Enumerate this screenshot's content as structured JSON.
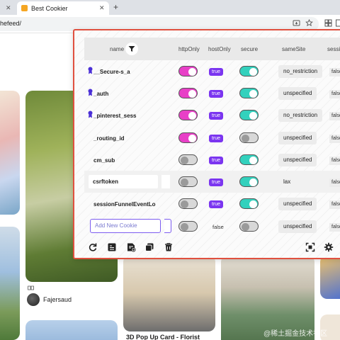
{
  "browser": {
    "tab_inactive_close": "✕",
    "tab_active_title": "Best Cookier",
    "tab_active_close": "✕",
    "new_tab": "+",
    "url": "hefeed/"
  },
  "page": {
    "author_name": "Fajersaud",
    "pin_title": "3D Pop Up Card - Florist",
    "watermark": "@稀土掘金技术社区"
  },
  "cookier": {
    "columns": {
      "name": "name",
      "httpOnly": "httpOnly",
      "hostOnly": "hostOnly",
      "secure": "secure",
      "sameSite": "sameSite",
      "session": "sessio"
    },
    "rows": [
      {
        "name": "__Secure-s_a",
        "pinned": true,
        "httpOnly": true,
        "hostOnly": "true",
        "secure": true,
        "sameSite": "no_restriction",
        "session": "false"
      },
      {
        "name": "_auth",
        "pinned": true,
        "httpOnly": true,
        "hostOnly": "true",
        "secure": true,
        "sameSite": "unspecified",
        "session": "false"
      },
      {
        "name": "_pinterest_sess",
        "pinned": true,
        "httpOnly": true,
        "hostOnly": "true",
        "secure": true,
        "sameSite": "no_restriction",
        "session": "false"
      },
      {
        "name": "_routing_id",
        "pinned": false,
        "httpOnly": true,
        "hostOnly": "true",
        "secure": false,
        "sameSite": "unspecified",
        "session": "false"
      },
      {
        "name": "cm_sub",
        "pinned": false,
        "httpOnly": false,
        "hostOnly": "true",
        "secure": true,
        "sameSite": "unspecified",
        "session": "false"
      },
      {
        "name": "csrftoken",
        "pinned": false,
        "httpOnly": false,
        "hostOnly": "true",
        "secure": true,
        "sameSite": "lax",
        "session": "false"
      },
      {
        "name": "sessionFunnelEventLo",
        "pinned": false,
        "httpOnly": false,
        "hostOnly": "true",
        "secure": true,
        "sameSite": "unspecified",
        "session": "false"
      }
    ],
    "new_row": {
      "placeholder": "Add New Cookie",
      "hostOnly": "false",
      "sameSite": "unspecified",
      "session": "false"
    },
    "colors": {
      "httpOnly_on": "#e83fc7",
      "secure_on": "#33d1bd",
      "badge": "#7b35f0",
      "border": "#e0503f"
    }
  }
}
